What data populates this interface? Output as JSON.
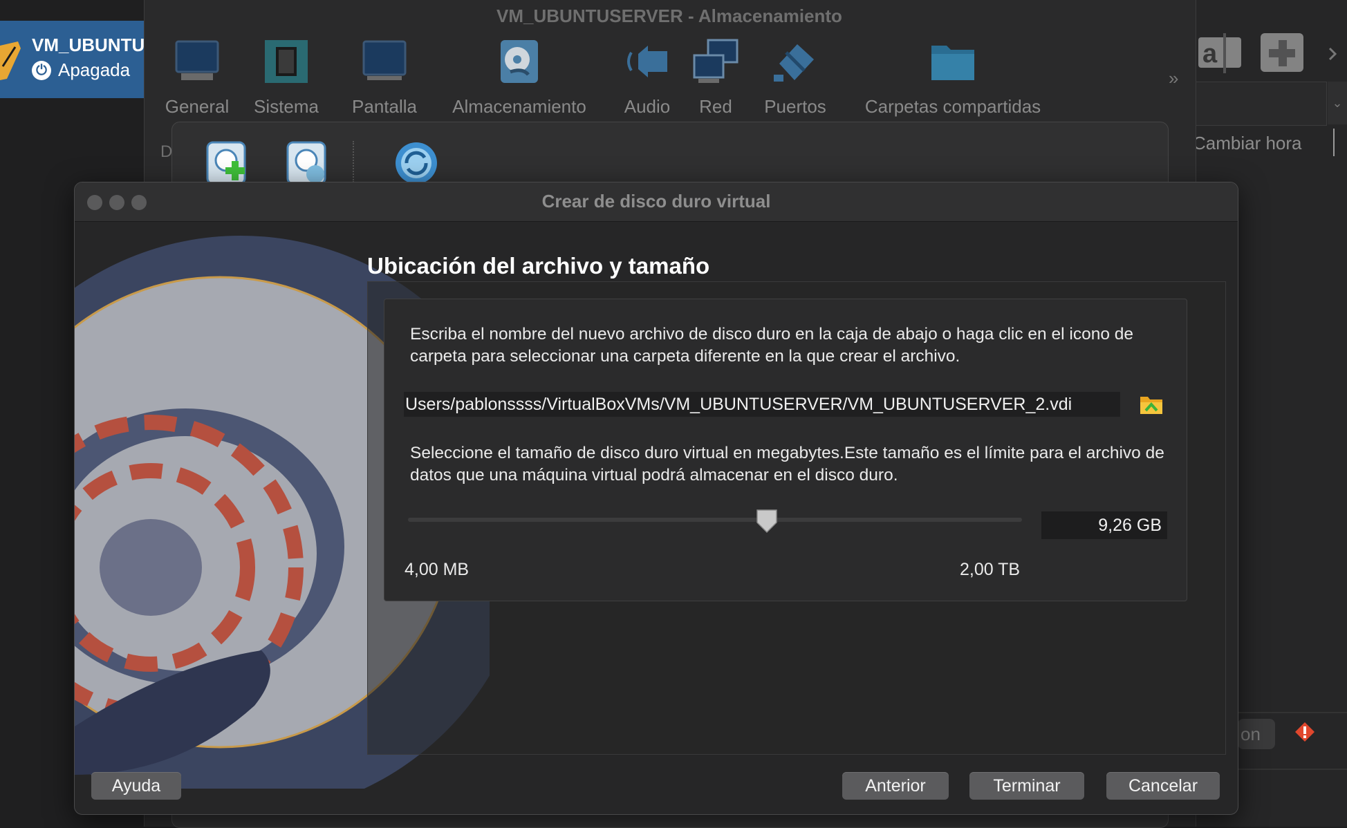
{
  "background": {
    "vm_name": "VM_UBUNTU",
    "vm_status": "Apagada",
    "right_pane": {
      "change_time_label": "Cambiar hora",
      "partial_button": "on"
    }
  },
  "settings_window": {
    "title": "VM_UBUNTUSERVER - Almacenamiento",
    "toolbar": [
      {
        "label": "General",
        "icon": "monitor-icon"
      },
      {
        "label": "Sistema",
        "icon": "chip-icon"
      },
      {
        "label": "Pantalla",
        "icon": "display-icon"
      },
      {
        "label": "Almacenamiento",
        "icon": "disk-icon"
      },
      {
        "label": "Audio",
        "icon": "speaker-icon"
      },
      {
        "label": "Red",
        "icon": "network-icon"
      },
      {
        "label": "Puertos",
        "icon": "ports-icon"
      },
      {
        "label": "Carpetas compartidas",
        "icon": "folder-icon"
      }
    ],
    "more": "»",
    "partial_label": "D"
  },
  "dialog": {
    "title": "Crear de disco duro virtual",
    "heading": "Ubicación del archivo y tamaño",
    "location_text": "Escriba el nombre del nuevo archivo de disco duro en la caja de abajo o haga clic en el icono de carpeta para seleccionar una carpeta diferente en la que crear el archivo.",
    "file_path": "Users/pablonssss/VirtualBoxVMs/VM_UBUNTUSERVER/VM_UBUNTUSERVER_2.vdi",
    "size_text": "Seleccione el tamaño de disco duro virtual en megabytes.Este tamaño es el límite para el archivo de datos que una máquina virtual podrá almacenar en el disco duro.",
    "size_value": "9,26 GB",
    "slider_position": 0.47,
    "min_label": "4,00 MB",
    "max_label": "2,00 TB",
    "buttons": {
      "help": "Ayuda",
      "back": "Anterior",
      "finish": "Terminar",
      "cancel": "Cancelar"
    }
  }
}
